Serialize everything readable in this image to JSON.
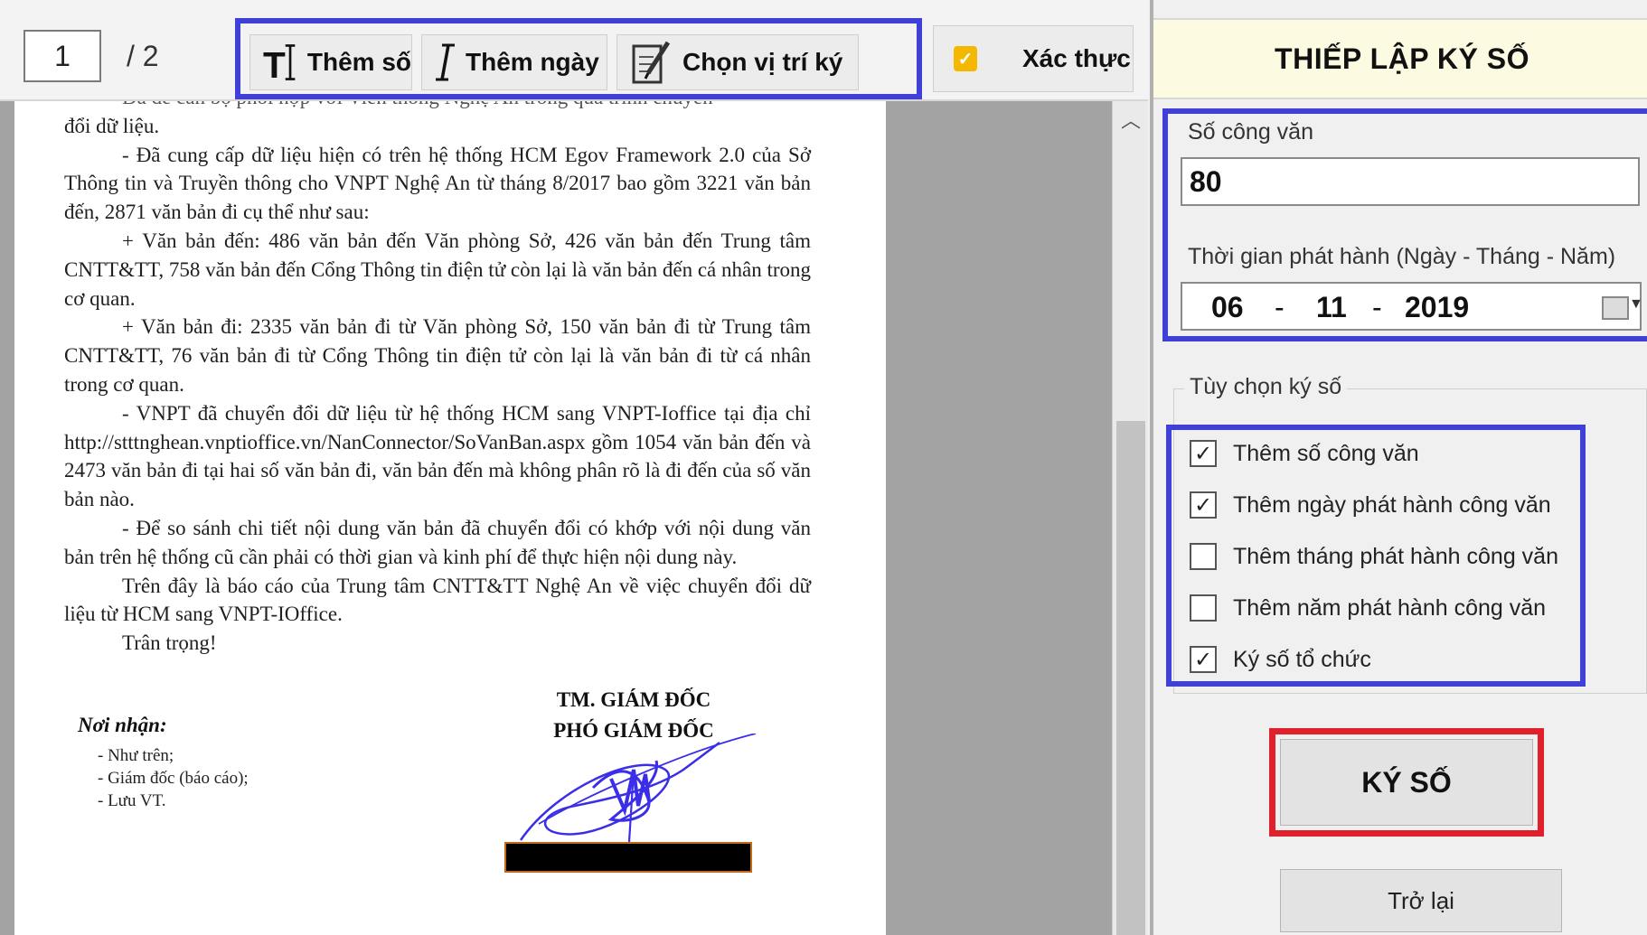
{
  "toolbar": {
    "page_current": "1",
    "page_total": "/ 2",
    "add_number_label": "Thêm số",
    "add_date_label": "Thêm ngày",
    "choose_position_label": "Chọn vị trí ký",
    "verify_label": "Xác thực"
  },
  "document": {
    "paragraphs": [
      "Đã đề cán bộ phối hợp với Viễn thông Nghệ An trong quá trình chuyển",
      "đổi dữ liệu.",
      "- Đã cung cấp dữ liệu hiện có trên hệ thống HCM Egov Framework 2.0 của Sở Thông tin và Truyền thông cho VNPT Nghệ An từ tháng 8/2017 bao gồm 3221 văn bản đến, 2871 văn bản đi cụ thể như sau:",
      "+ Văn bản đến: 486 văn bản đến Văn phòng Sở, 426 văn bản đến Trung tâm CNTT&TT, 758 văn bản đến Cổng Thông tin điện tử còn lại là văn bản đến cá nhân trong cơ quan.",
      "+ Văn bản đi: 2335 văn bản đi từ Văn phòng Sở, 150 văn bản đi từ Trung tâm CNTT&TT, 76 văn bản đi từ Cổng Thông tin điện tử còn lại là văn bản đi từ cá nhân trong cơ quan.",
      "- VNPT đã chuyển đổi dữ liệu từ hệ thống HCM sang VNPT-Ioffice tại địa chỉ http://stttnghean.vnptioffice.vn/NanConnector/SoVanBan.aspx gồm 1054 văn bản đến và 2473 văn bản đi tại hai số văn bản đi, văn bản đến mà không phân rõ là đi đến của số văn bản nào.",
      "- Để so sánh chi tiết nội dung văn bản đã chuyển đổi có khớp với nội dung văn bản trên hệ thống cũ cần phải có thời gian và kinh phí để thực hiện nội dung này.",
      "Trên đây là báo cáo của Trung tâm CNTT&TT Nghệ An về việc chuyển đổi dữ liệu từ HCM sang VNPT-IOffice.",
      "Trân trọng!"
    ],
    "recipients_title": "Nơi nhận:",
    "recipients": [
      "- Như trên;",
      "- Giám đốc (báo cáo);",
      "- Lưu VT."
    ],
    "signer_line1": "TM. GIÁM ĐỐC",
    "signer_line2": "PHÓ GIÁM ĐỐC"
  },
  "panel": {
    "title": "THIẾP LẬP KÝ SỐ",
    "number_label": "Số công văn",
    "number_value": "80",
    "date_label": "Thời gian phát hành (Ngày - Tháng - Năm)",
    "date_day": "06",
    "date_month": "11",
    "date_year": "2019",
    "date_sep": "-",
    "options_legend": "Tùy chọn ký số",
    "options": [
      {
        "label": "Thêm số công văn",
        "checked": true
      },
      {
        "label": "Thêm ngày phát hành công văn",
        "checked": true
      },
      {
        "label": "Thêm tháng phát hành công văn",
        "checked": false
      },
      {
        "label": "Thêm năm phát hành công văn",
        "checked": false
      },
      {
        "label": "Ký số tổ chức",
        "checked": true
      }
    ],
    "sign_button": "KÝ SỐ",
    "back_button": "Trở lại"
  },
  "colors": {
    "highlight_blue": "#4040d8",
    "highlight_red": "#e0202a",
    "header_bg": "#fcfbe2",
    "signature_ink": "#3a2ee8"
  },
  "icons": [
    "text-cursor-icon",
    "italic-cursor-icon",
    "pen-paper-icon",
    "checkmark-icon",
    "calendar-icon",
    "scroll-up-icon"
  ]
}
